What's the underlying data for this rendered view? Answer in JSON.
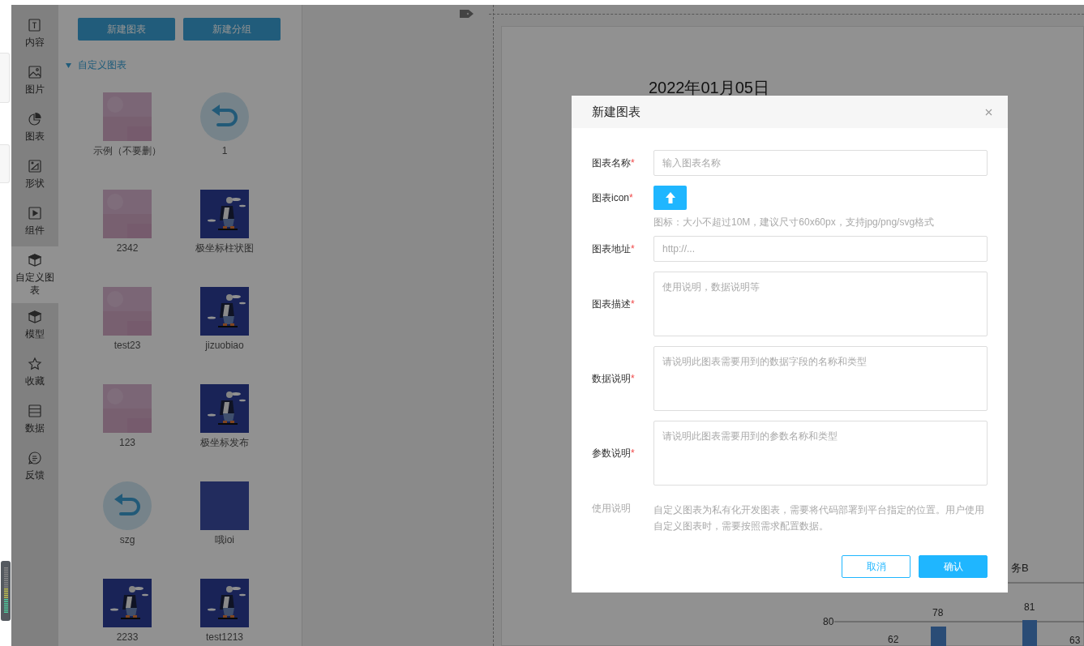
{
  "sidebar": {
    "items": [
      {
        "label": "内容",
        "selected": false
      },
      {
        "label": "图片",
        "selected": false
      },
      {
        "label": "图表",
        "selected": false
      },
      {
        "label": "形状",
        "selected": false
      },
      {
        "label": "组件",
        "selected": false
      },
      {
        "label": "自定义图表",
        "selected": true
      },
      {
        "label": "模型",
        "selected": false
      },
      {
        "label": "收藏",
        "selected": false
      },
      {
        "label": "数据",
        "selected": false
      },
      {
        "label": "反馈",
        "selected": false
      }
    ]
  },
  "panel": {
    "buttons": [
      "新建图表",
      "新建分组"
    ],
    "group": {
      "title": "自定义图表",
      "expanded": true,
      "items": [
        {
          "label": "示例（不要删）",
          "kind": "pink"
        },
        {
          "label": "1",
          "kind": "undo"
        },
        {
          "label": "2342",
          "kind": "pink"
        },
        {
          "label": "极坐标柱状图",
          "kind": "picture"
        },
        {
          "label": "test23",
          "kind": "pink"
        },
        {
          "label": "jizuobiao",
          "kind": "picture"
        },
        {
          "label": "123",
          "kind": "pink"
        },
        {
          "label": "极坐标发布",
          "kind": "picture"
        },
        {
          "label": "szg",
          "kind": "undo"
        },
        {
          "label": "哦ioi",
          "kind": "blue"
        },
        {
          "label": "2233",
          "kind": "picture"
        },
        {
          "label": "test1213",
          "kind": "picture"
        }
      ]
    }
  },
  "canvas": {
    "date": "2022年01月05日",
    "chart": {
      "legend": "务B",
      "tick": "80",
      "labels": [
        "62",
        "78",
        "81",
        "63"
      ]
    }
  },
  "dialog": {
    "title": "新建图表",
    "required_mark": "*",
    "fields": [
      {
        "kind": "input",
        "label": "图表名称",
        "required": true,
        "placeholder": "输入图表名称"
      },
      {
        "kind": "upload",
        "label": "图表icon",
        "required": true,
        "hint": "图标：大小不超过10M，建议尺寸60x60px，支持jpg/png/svg格式"
      },
      {
        "kind": "input",
        "label": "图表地址",
        "required": true,
        "placeholder": "http://..."
      },
      {
        "kind": "textarea",
        "label": "图表描述",
        "required": true,
        "placeholder": "使用说明，数据说明等"
      },
      {
        "kind": "textarea",
        "label": "数据说明",
        "required": true,
        "placeholder": "请说明此图表需要用到的数据字段的名称和类型"
      },
      {
        "kind": "textarea",
        "label": "参数说明",
        "required": true,
        "placeholder": "请说明此图表需要用到的参数名称和类型"
      },
      {
        "kind": "note",
        "label": "使用说明",
        "required": false,
        "text": "自定义图表为私有化开发图表，需要将代码部署到平台指定的位置。用户使用自定义图表时，需要按照需求配置数据。"
      }
    ],
    "buttons": [
      {
        "label": "取消",
        "kind": "secondary"
      },
      {
        "label": "确认",
        "kind": "primary"
      }
    ]
  }
}
